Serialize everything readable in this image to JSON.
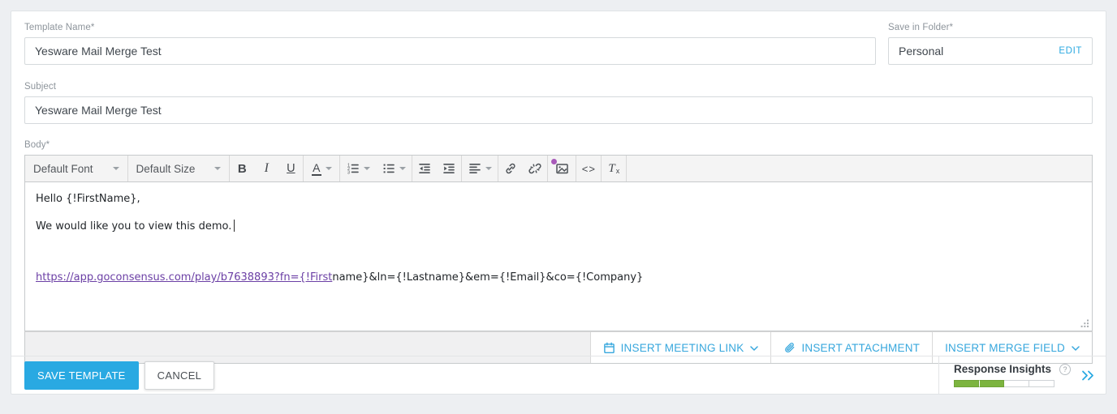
{
  "colors": {
    "accent_blue": "#29a9e2",
    "link_purple": "#6b3fa5",
    "insights_green": "#7cb43f",
    "image_badge_purple": "#a85ab9",
    "page_background": "#edeff2"
  },
  "fields": {
    "template_name": {
      "label": "Template Name*",
      "value": "Yesware Mail Merge Test"
    },
    "folder": {
      "label": "Save in Folder*",
      "value": "Personal",
      "edit_label": "EDIT"
    },
    "subject": {
      "label": "Subject",
      "value": "Yesware Mail Merge Test"
    },
    "body": {
      "label": "Body*"
    }
  },
  "editor": {
    "toolbar": {
      "font_dropdown": "Default Font",
      "size_dropdown": "Default Size",
      "glyphs": {
        "bold": "B",
        "italic": "I",
        "underline": "U",
        "font_color": "A",
        "code": "<>",
        "clear_format_t": "T",
        "clear_format_x": "x"
      },
      "icons": [
        "bold",
        "italic",
        "underline",
        "font-color",
        "ordered-list",
        "unordered-list",
        "outdent",
        "indent",
        "align",
        "insert-link",
        "remove-link",
        "insert-image",
        "code-view",
        "clear-formatting"
      ]
    },
    "content": {
      "greeting": "Hello {!FirstName},",
      "line2": "We would like you to view this demo.",
      "link_underlined": "https://app.goconsensus.com/play/b7638893?fn={!First",
      "link_plain": "name}&ln={!Lastname}&em={!Email}&co={!Company}"
    },
    "insert_bar": {
      "meeting_link": "INSERT MEETING LINK",
      "attachment": "INSERT ATTACHMENT",
      "merge_field": "INSERT MERGE FIELD"
    }
  },
  "footer": {
    "save_label": "SAVE TEMPLATE",
    "cancel_label": "CANCEL",
    "insights": {
      "title": "Response Insights",
      "help_glyph": "?",
      "segments_total": 4,
      "segments_filled": 2
    }
  }
}
